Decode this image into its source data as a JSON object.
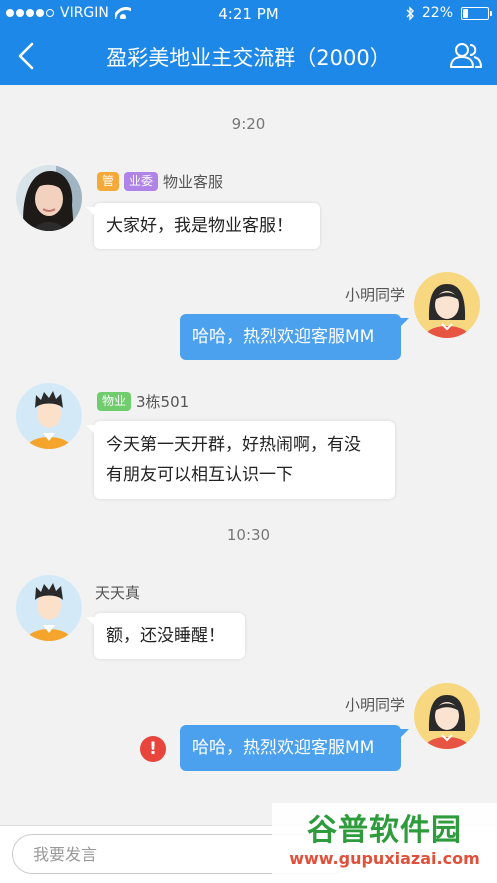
{
  "status_bar": {
    "carrier": "VIRGIN",
    "time": "4:21 PM",
    "battery": "22%",
    "battery_level": 0.22
  },
  "nav": {
    "title": "盈彩美地业主交流群（2000）",
    "back_icon": "chevron-left-icon",
    "group_icon": "group-members-icon"
  },
  "chat": {
    "timestamps": [
      "9:20",
      "10:30"
    ],
    "messages": [
      {
        "side": "left",
        "tags": [
          "管",
          "业委"
        ],
        "sender": "物业客服",
        "text": "大家好，我是物业客服！"
      },
      {
        "side": "right",
        "sender": "小明同学",
        "text": "哈哈，热烈欢迎客服MM"
      },
      {
        "side": "left",
        "tags": [
          "物业"
        ],
        "sender": "3栋501",
        "text_line1": "今天第一天开群，好热闹啊，有没",
        "text_line2": "有朋友可以相互认识一下"
      },
      {
        "side": "left",
        "sender": "天天真",
        "text": "额，还没睡醒！"
      },
      {
        "side": "right",
        "sender": "小明同学",
        "text": "哈哈，热烈欢迎客服MM",
        "error": "!"
      }
    ]
  },
  "input": {
    "placeholder": "我要发言"
  },
  "watermark": {
    "title": "谷普软件园",
    "url": "www.gupuxiazai.com"
  },
  "colors": {
    "header": "#1e88e8",
    "bubble_right": "#4ca1ef",
    "tag_orange": "#f4a938",
    "tag_purple": "#b083e9",
    "tag_green": "#6fcd6d",
    "error": "#e8453c"
  }
}
